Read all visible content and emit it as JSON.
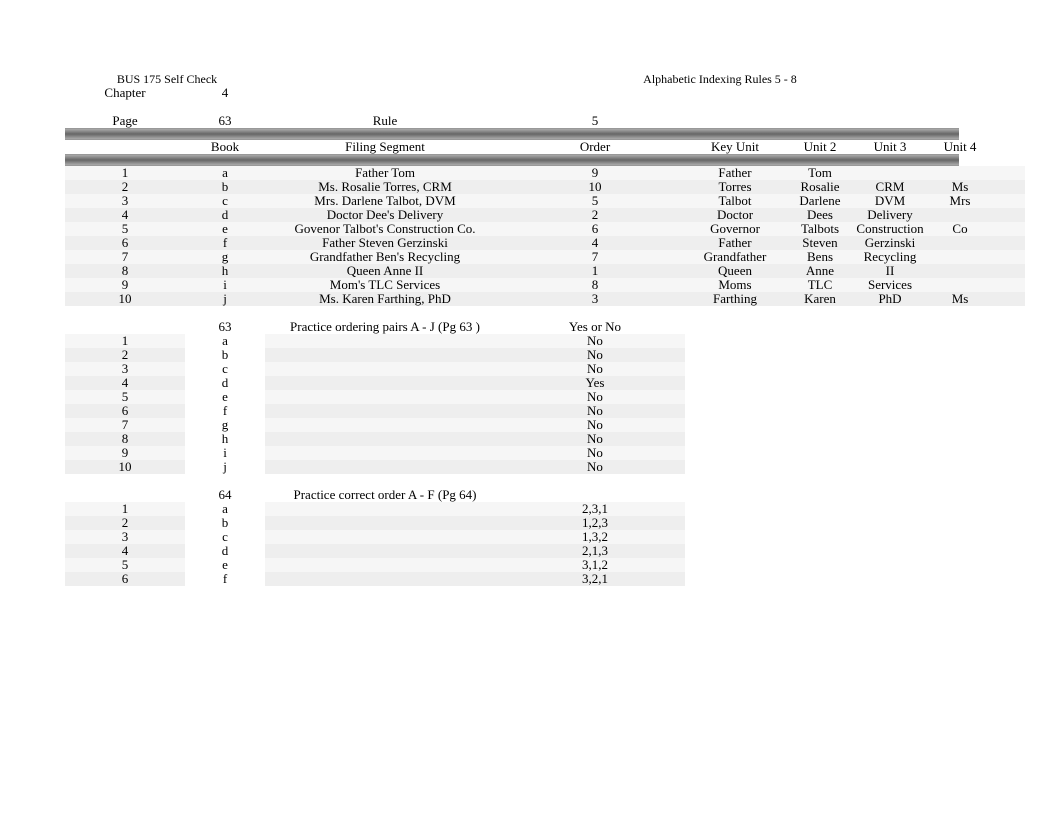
{
  "doc_title_left": "BUS 175 Self Check",
  "doc_title_right": "Alphabetic Indexing Rules 5 - 8",
  "chapter_label": "Chapter",
  "chapter_num": "4",
  "page_label": "Page",
  "page_num": "63",
  "rule_label": "Rule",
  "rule_num": "5",
  "hdr": {
    "book": "Book",
    "filing_segment": "Filing Segment",
    "order": "Order",
    "key_unit": "Key Unit",
    "unit2": "Unit 2",
    "unit3": "Unit 3",
    "unit4": "Unit 4"
  },
  "rows1": [
    {
      "n": "1",
      "b": "a",
      "fs": "Father Tom",
      "o": "9",
      "ku": "Father",
      "u2": "Tom",
      "u3": "",
      "u4": ""
    },
    {
      "n": "2",
      "b": "b",
      "fs": "Ms. Rosalie Torres, CRM",
      "o": "10",
      "ku": "Torres",
      "u2": "Rosalie",
      "u3": "CRM",
      "u4": "Ms"
    },
    {
      "n": "3",
      "b": "c",
      "fs": "Mrs. Darlene Talbot, DVM",
      "o": "5",
      "ku": "Talbot",
      "u2": "Darlene",
      "u3": "DVM",
      "u4": "Mrs"
    },
    {
      "n": "4",
      "b": "d",
      "fs": "Doctor Dee's Delivery",
      "o": "2",
      "ku": "Doctor",
      "u2": "Dees",
      "u3": "Delivery",
      "u4": ""
    },
    {
      "n": "5",
      "b": "e",
      "fs": "Govenor Talbot's Construction Co.",
      "o": "6",
      "ku": "Governor",
      "u2": "Talbots",
      "u3": "Construction",
      "u4": "Co"
    },
    {
      "n": "6",
      "b": "f",
      "fs": "Father Steven Gerzinski",
      "o": "4",
      "ku": "Father",
      "u2": "Steven",
      "u3": "Gerzinski",
      "u4": ""
    },
    {
      "n": "7",
      "b": "g",
      "fs": "Grandfather Ben's Recycling",
      "o": "7",
      "ku": "Grandfather",
      "u2": "Bens",
      "u3": "Recycling",
      "u4": ""
    },
    {
      "n": "8",
      "b": "h",
      "fs": "Queen Anne II",
      "o": "1",
      "ku": "Queen",
      "u2": "Anne",
      "u3": "II",
      "u4": ""
    },
    {
      "n": "9",
      "b": "i",
      "fs": "Mom's TLC Services",
      "o": "8",
      "ku": "Moms",
      "u2": "TLC",
      "u3": "Services",
      "u4": ""
    },
    {
      "n": "10",
      "b": "j",
      "fs": "Ms. Karen Farthing, PhD",
      "o": "3",
      "ku": "Farthing",
      "u2": "Karen",
      "u3": "PhD",
      "u4": "Ms"
    }
  ],
  "section2": {
    "page": "63",
    "title": "Practice ordering pairs A - J (Pg 63 )",
    "ord_label": "Yes or No",
    "rows": [
      {
        "n": "1",
        "b": "a",
        "ans": "No"
      },
      {
        "n": "2",
        "b": "b",
        "ans": "No"
      },
      {
        "n": "3",
        "b": "c",
        "ans": "No"
      },
      {
        "n": "4",
        "b": "d",
        "ans": "Yes"
      },
      {
        "n": "5",
        "b": "e",
        "ans": "No"
      },
      {
        "n": "6",
        "b": "f",
        "ans": "No"
      },
      {
        "n": "7",
        "b": "g",
        "ans": "No"
      },
      {
        "n": "8",
        "b": "h",
        "ans": "No"
      },
      {
        "n": "9",
        "b": "i",
        "ans": "No"
      },
      {
        "n": "10",
        "b": "j",
        "ans": "No"
      }
    ]
  },
  "section3": {
    "page": "64",
    "title": "Practice correct order A - F (Pg 64)",
    "rows": [
      {
        "n": "1",
        "b": "a",
        "ans": "2,3,1"
      },
      {
        "n": "2",
        "b": "b",
        "ans": "1,2,3"
      },
      {
        "n": "3",
        "b": "c",
        "ans": "1,3,2"
      },
      {
        "n": "4",
        "b": "d",
        "ans": "2,1,3"
      },
      {
        "n": "5",
        "b": "e",
        "ans": "3,1,2"
      },
      {
        "n": "6",
        "b": "f",
        "ans": "3,2,1"
      }
    ]
  }
}
